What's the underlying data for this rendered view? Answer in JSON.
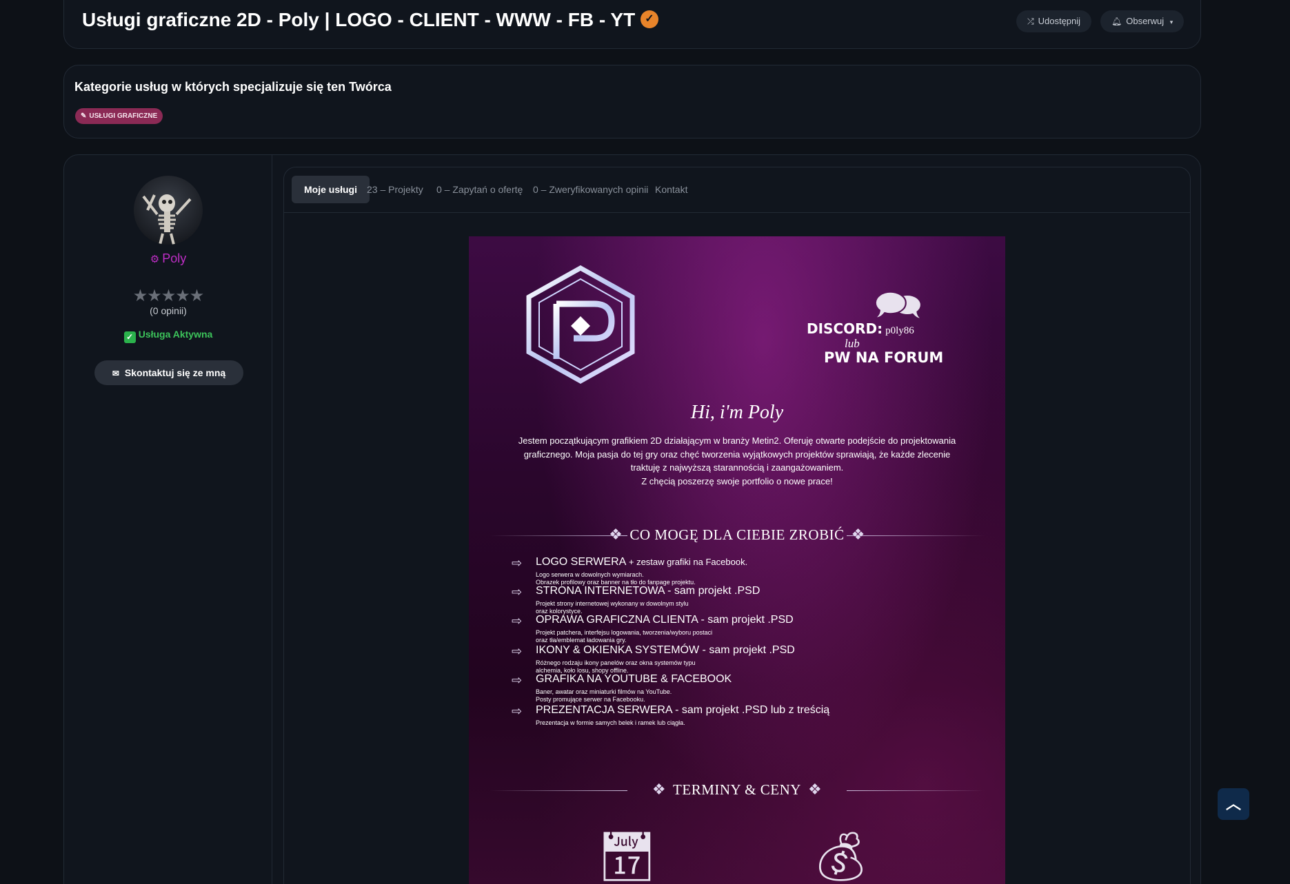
{
  "header": {
    "title": "Usługi graficzne 2D - Poly | LOGO - CLIENT - WWW - FB - YT",
    "share_label": "Udostępnij",
    "follow_label": "Obserwuj"
  },
  "categories": {
    "title": "Kategorie usług w których specjalizuje się ten Twórca",
    "badge": "USŁUGI GRAFICZNE"
  },
  "sidebar": {
    "username": "Poly",
    "rating": 0,
    "reviews": "(0 opinii)",
    "status": "Usługa Aktywna",
    "contact_label": "Skontaktuj się ze mną"
  },
  "tabs": [
    {
      "label": "Moje usługi",
      "active": true
    },
    {
      "label": "23 – Projekty"
    },
    {
      "label": "0 – Zapytań o ofertę"
    },
    {
      "label": "0 – Zweryfikowanych opinii"
    },
    {
      "label": "Kontakt"
    }
  ],
  "poster": {
    "discord_label": "DISCORD:",
    "discord_handle": "p0ly86",
    "lub": "lub",
    "pw": "PW NA FORUM",
    "hi": "Hi, i'm Poly",
    "intro": "Jestem początkującym grafikiem 2D działającym w branży Metin2. Oferuję otwarte podejście do projektowania graficznego. Moja pasja do tej gry oraz chęć tworzenia wyjątkowych projektów sprawiają, że każde zlecenie traktuję z najwyższą starannością i zaangażowaniem.\nZ chęcią poszerzę swoje portfolio o nowe prace!",
    "section1": "CO MOGĘ DLA CIEBIE ZROBIĆ",
    "section2": "TERMINY & CENY",
    "services": [
      {
        "title": "LOGO SERWERA",
        "sub": "+ zestaw grafiki na Facebook.",
        "desc": "Logo serwera w dowolnych wymiarach.\nObrazek profilowy oraz banner na tło do fanpage projektu."
      },
      {
        "title": "STRONA INTERNETOWA - sam projekt .PSD",
        "sub": "",
        "desc": "Projekt strony internetowej wykonany w dowolnym stylu\noraz kolorystyce."
      },
      {
        "title": "OPRAWA GRAFICZNA CLIENTA - sam projekt .PSD",
        "sub": "",
        "desc": "Projekt patchera, interfejsu logowania, tworzenia/wyboru postaci\noraz tła/emblemat ładowania gry."
      },
      {
        "title": "IKONY & OKIENKA SYSTEMÓW - sam projekt .PSD",
        "sub": "",
        "desc": "Różnego rodzaju ikony panelów oraz okna systemów typu\nalchemia, koło losu, shopy offline."
      },
      {
        "title": "GRAFIKA NA YOUTUBE & FACEBOOK",
        "sub": "",
        "desc": "Baner, awatar oraz miniaturki filmów na YouTube.\nPosty promujące serwer na Facebooku."
      },
      {
        "title": "PREZENTACJA SERWERA - sam projekt .PSD lub z treścią",
        "sub": "",
        "desc": "Prezentacja w formie samych belek i ramek lub ciągła."
      }
    ]
  },
  "icons": {
    "share": "share-icon",
    "bell": "bell-icon",
    "verified": "verified-badge-icon",
    "brush": "brush-icon",
    "envelope": "envelope-icon",
    "chat": "chat-bubbles-icon",
    "calendar": "calendar-clock-icon",
    "money": "coins-money-icon",
    "scroll_top": "chevron-up-icon"
  }
}
